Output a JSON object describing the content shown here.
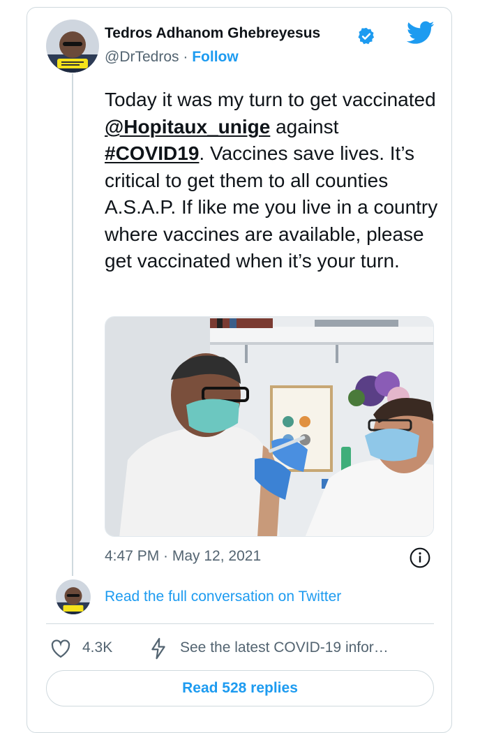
{
  "author": {
    "name": "Tedros Adhanom Ghebreyesus",
    "handle": "@DrTedros",
    "separator": "·",
    "follow_label": "Follow",
    "verified": true
  },
  "tweet": {
    "text_1": "Today it was my turn to get vaccinated ",
    "mention": "@Hopitaux_unige",
    "text_2": " against ",
    "hashtag": "#COVID19",
    "text_3": ". Vaccines save lives. It’s critical to get them to all counties A.S.A.P. If like me you live in a country where vaccines are available, please get vaccinated when it’s your turn.",
    "timestamp": "4:47 PM · May 12, 2021"
  },
  "conversation": {
    "read_full_label": "Read the full conversation on Twitter"
  },
  "actions": {
    "likes_count": "4.3K",
    "covid_info_label": "See the latest COVID-19 infor…",
    "replies_label": "Read 528 replies"
  },
  "icons": {
    "brand": "twitter-bird-icon",
    "verified": "verified-badge-icon",
    "info": "info-icon",
    "like": "heart-icon",
    "covid": "bolt-icon"
  },
  "colors": {
    "accent": "#1d9bf0",
    "secondary_text": "#536471",
    "border": "#cfd9de"
  }
}
